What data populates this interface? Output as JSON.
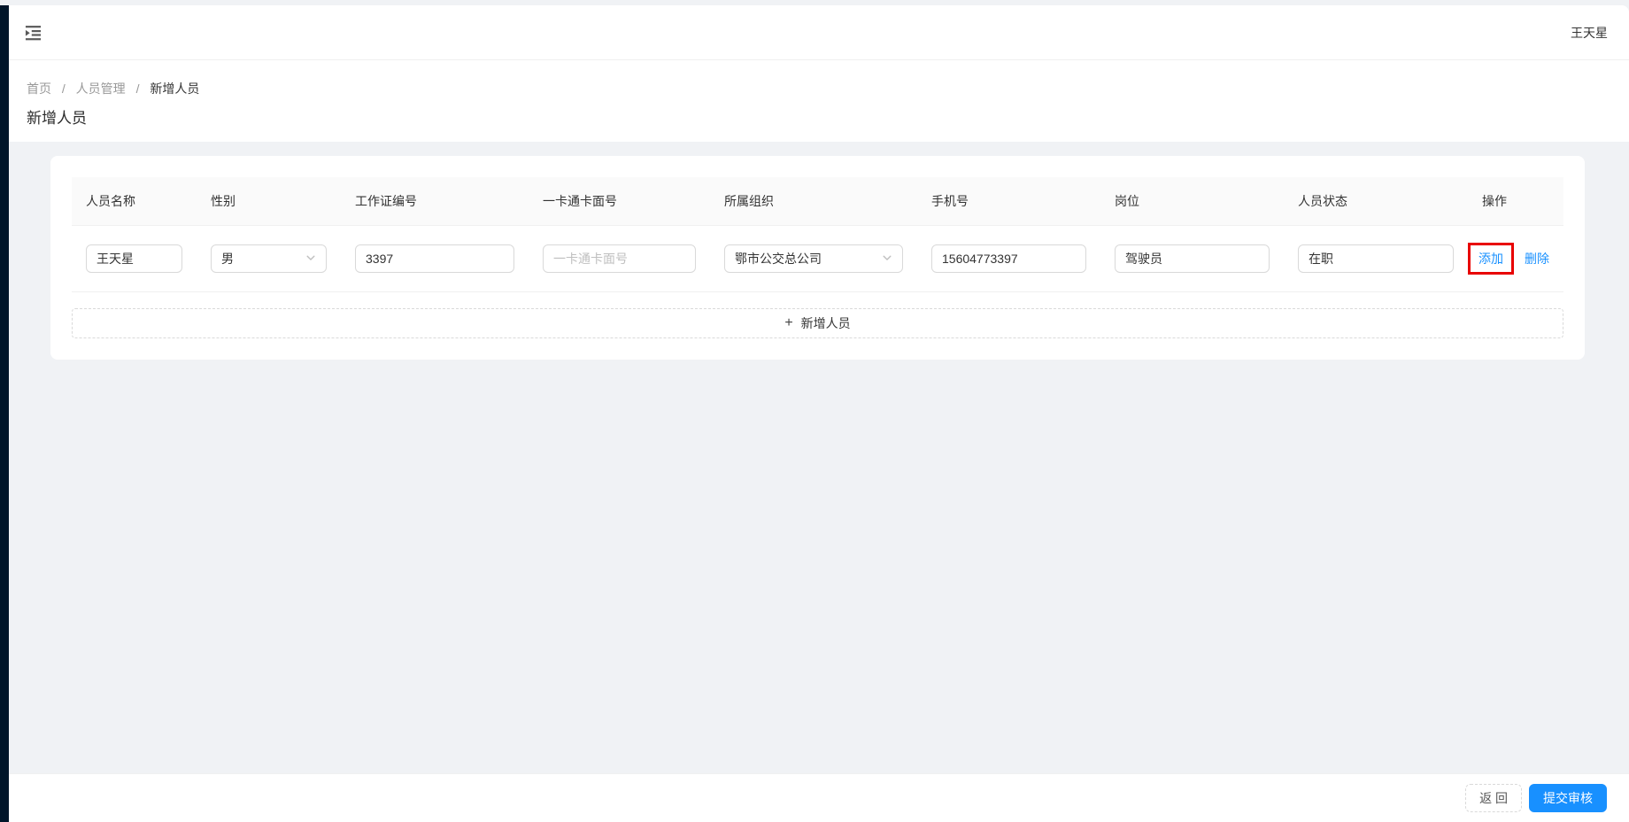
{
  "topbar": {
    "username": "王天星"
  },
  "breadcrumb": {
    "home": "首页",
    "section": "人员管理",
    "current": "新增人员",
    "separator": "/"
  },
  "page": {
    "title": "新增人员"
  },
  "table": {
    "headers": [
      "人员名称",
      "性别",
      "工作证编号",
      "一卡通卡面号",
      "所属组织",
      "手机号",
      "岗位",
      "人员状态",
      "操作"
    ],
    "row": {
      "name": "王天星",
      "gender": "男",
      "work_id": "3397",
      "card_placeholder": "一卡通卡面号",
      "organization": "鄂市公交总公司",
      "phone": "15604773397",
      "post": "驾驶员",
      "status": "在职",
      "add_label": "添加",
      "delete_label": "删除"
    },
    "add_row": {
      "plus": "+",
      "label": "新增人员"
    }
  },
  "footer": {
    "back_label": "返 回",
    "submit_label": "提交审核"
  },
  "icons": {
    "menu_unfold": "menu-unfold-icon",
    "select_arrow": "chevron-down-icon"
  },
  "colors": {
    "accent": "#1890ff",
    "annotation_red": "#e80000",
    "sider_dark": "#001529",
    "page_bg": "#f0f2f5"
  }
}
